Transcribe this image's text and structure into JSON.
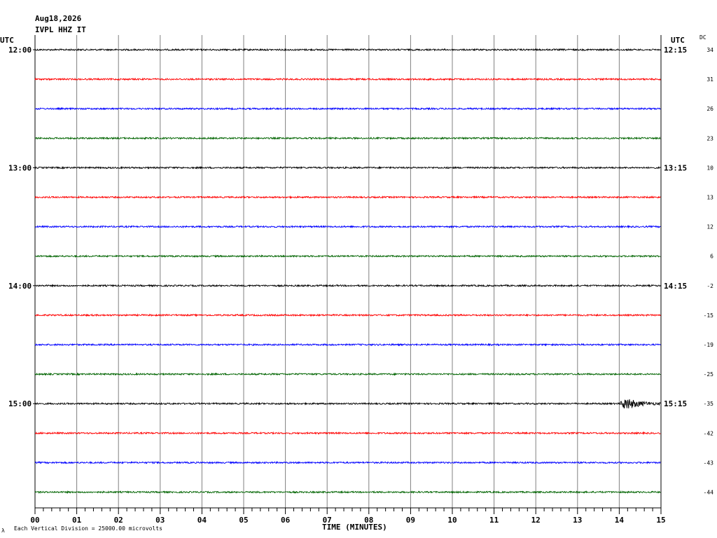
{
  "header": {
    "date": "Aug18,2026",
    "station": "IVPL HHZ IT",
    "left_axis_title": "UTC",
    "right_axis_title": "UTC",
    "dc_title": "DC"
  },
  "footer": {
    "scale_note": "Each Vertical Division = 25000.00 microvolts",
    "corner_mark": "λ",
    "xlabel": "TIME (MINUTES)"
  },
  "chart_data": {
    "type": "line",
    "title": "",
    "xlabel": "TIME (MINUTES)",
    "xlim": [
      0,
      15
    ],
    "x_ticks": [
      "00",
      "01",
      "02",
      "03",
      "04",
      "05",
      "06",
      "07",
      "08",
      "09",
      "10",
      "11",
      "12",
      "13",
      "14",
      "15"
    ],
    "left_hour_labels": [
      "12:00",
      "13:00",
      "14:00",
      "15:00"
    ],
    "right_hour_labels": [
      "12:15",
      "13:15",
      "14:15",
      "15:15"
    ],
    "dc_offsets": [
      "34",
      "31",
      "26",
      "23",
      "10",
      "13",
      "12",
      "6",
      "-2",
      "-15",
      "-19",
      "-25",
      "-35",
      "-42",
      "-43",
      "-44"
    ],
    "trace_colors": [
      "#000000",
      "#ff0000",
      "#0000ff",
      "#006400"
    ],
    "rows_per_hour": 4,
    "minutes_per_row": 15,
    "event": {
      "row": 12,
      "start_minute": 14.0,
      "end_minute": 15.0,
      "peak_amplitude_fraction": 0.45
    },
    "grid": true
  },
  "colors": {
    "grid": "#808080",
    "frame": "#000000"
  }
}
